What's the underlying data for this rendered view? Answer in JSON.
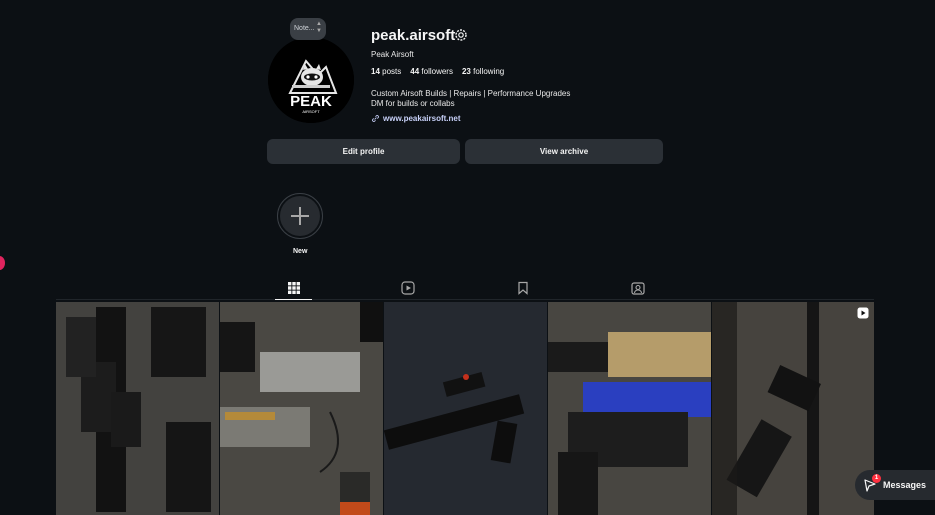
{
  "profile": {
    "username": "peak.airsoft",
    "full_name": "Peak Airsoft",
    "avatar_logo_text": "PEAK",
    "avatar_logo_sub": "AIRSOFT",
    "note_placeholder": "Note...",
    "stats": {
      "posts_count": "14",
      "posts_label": "posts",
      "followers_count": "44",
      "followers_label": "followers",
      "following_count": "23",
      "following_label": "following"
    },
    "bio_line1": "Custom Airsoft Builds | Repairs | Performance Upgrades",
    "bio_line2": "DM for builds or collabs",
    "website": "www.peakairsoft.net"
  },
  "actions": {
    "edit_profile": "Edit profile",
    "view_archive": "View archive"
  },
  "highlights": {
    "new_label": "New"
  },
  "tabs": [
    {
      "name": "posts",
      "icon": "grid-icon",
      "active": true
    },
    {
      "name": "reels",
      "icon": "reels-icon",
      "active": false
    },
    {
      "name": "saved",
      "icon": "bookmark-icon",
      "active": false
    },
    {
      "name": "tagged",
      "icon": "tagged-icon",
      "active": false
    }
  ],
  "posts": [
    {
      "subject": "tactical vest and magazine pouches"
    },
    {
      "subject": "open gearbox and internal parts"
    },
    {
      "subject": "airsoft rifle with red dot sight"
    },
    {
      "subject": "gearbox on blue work stand"
    },
    {
      "subject": "airsoft rifle close-up",
      "is_reel": true
    }
  ],
  "messages": {
    "label": "Messages",
    "badge": "1"
  },
  "colors": {
    "background": "#0c1014",
    "button_bg": "#2b3036",
    "link": "#c7d0f8",
    "notification_badge": "#ff3040"
  }
}
